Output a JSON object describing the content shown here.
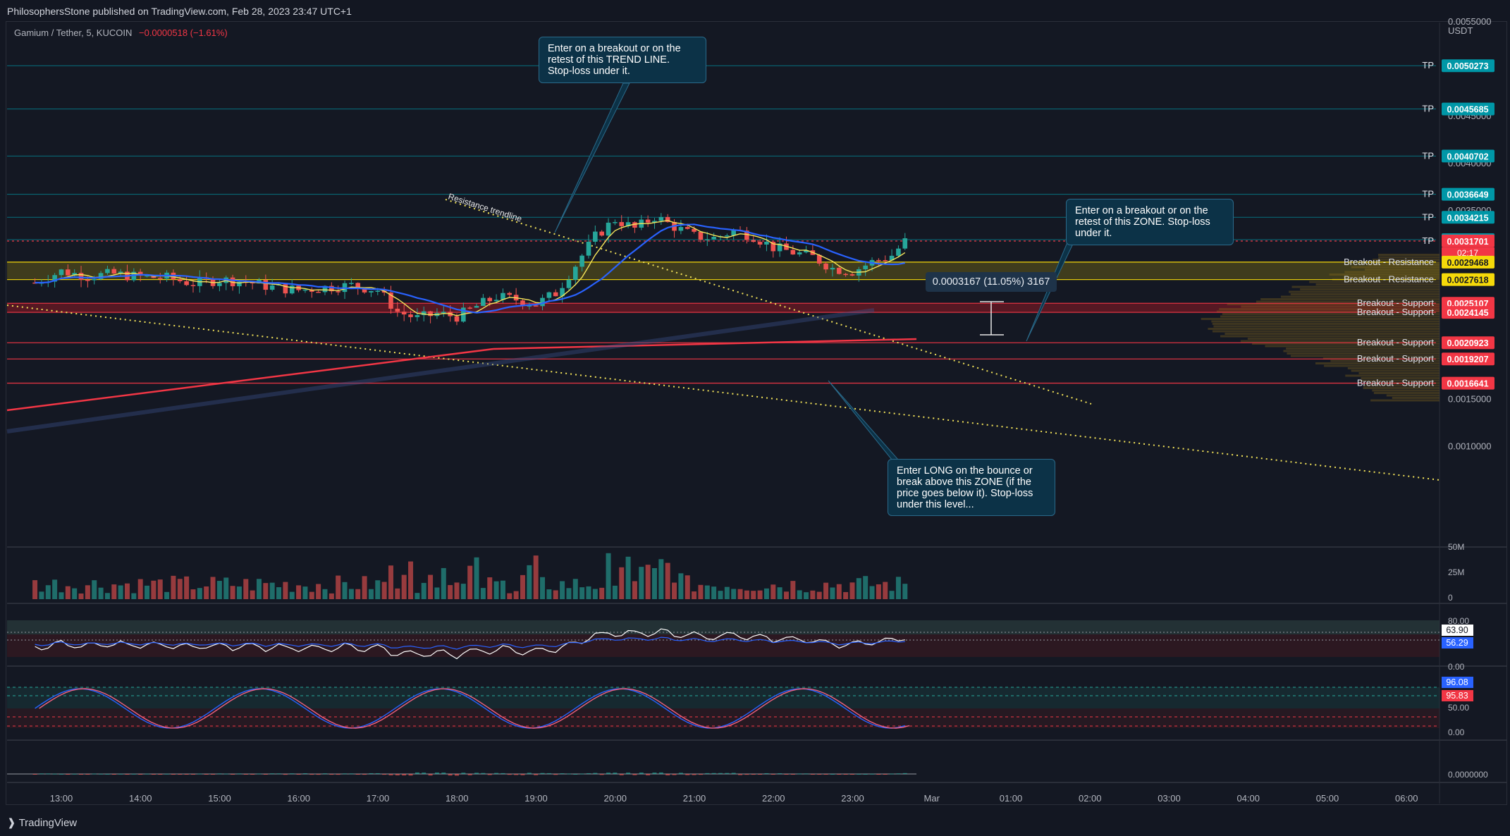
{
  "header": {
    "published": "PhilosophersStone published on TradingView.com, Feb 28, 2023 23:47 UTC+1",
    "symbol": "Gamium / Tether, 5, KUCOIN",
    "change": "−0.0000518 (−1.61%)"
  },
  "footer": {
    "brand": "TradingView",
    "logo_icon": "tradingview-logo-icon"
  },
  "annotations": {
    "trendline_label": "Resistance trendline",
    "callout_trendline": "Enter on a breakout or on the\nretest of this TREND LINE.\nStop-loss under it.",
    "callout_zone": "Enter on a breakout or on the\nretest of this ZONE. Stop-loss\nunder it.",
    "callout_long": "Enter LONG on the bounce or\nbreak above this ZONE (if the\nprice goes below it). Stop-loss\nunder this level...",
    "measure": "0.0003167 (11.05%) 3167"
  },
  "colors": {
    "background": "#131722",
    "up": "#26a69a",
    "down": "#ef5350",
    "tp": "#0097a7",
    "support": "#f23645",
    "resistance": "#f5d90a",
    "ma_fast": "#f5e55a",
    "ma_mid": "#2962ff",
    "ma_slow": "#f23645"
  },
  "chart_data": {
    "type": "candlestick",
    "currency": "USDT",
    "x_ticks": [
      "13:00",
      "14:00",
      "15:00",
      "16:00",
      "17:00",
      "18:00",
      "19:00",
      "20:00",
      "21:00",
      "22:00",
      "23:00",
      "Mar",
      "01:00",
      "02:00",
      "03:00",
      "04:00",
      "05:00",
      "06:00"
    ],
    "y_ticks": [
      "0.0055000",
      "0.0050000",
      "0.0045000",
      "0.0040000",
      "0.0035000",
      "0.0015000",
      "0.0010000"
    ],
    "ylim": [
      0.00088,
      0.00585
    ],
    "levels": [
      {
        "label": "TP",
        "price": "0.0050273",
        "value": 0.0050273,
        "kind": "tp"
      },
      {
        "label": "TP",
        "price": "0.0045685",
        "value": 0.0045685,
        "kind": "tp"
      },
      {
        "label": "TP",
        "price": "0.0040702",
        "value": 0.0040702,
        "kind": "tp"
      },
      {
        "label": "TP",
        "price": "0.0036649",
        "value": 0.0036649,
        "kind": "tp"
      },
      {
        "label": "TP",
        "price": "0.0034215",
        "value": 0.0034215,
        "kind": "tp"
      },
      {
        "label": "",
        "price": "0.0031842",
        "value": 0.0031842,
        "kind": "tp"
      },
      {
        "label": "TP",
        "price": "0.0031701",
        "value": 0.0031701,
        "kind": "last",
        "timer": "02:17"
      },
      {
        "label": "Breakout - Resistance",
        "price": "0.0029468",
        "value": 0.0029468,
        "kind": "resistance"
      },
      {
        "label": "Breakout - Resistance",
        "price": "0.0027618",
        "value": 0.0027618,
        "kind": "resistance"
      },
      {
        "label": "Breakout - Support",
        "price": "0.0025107",
        "value": 0.0025107,
        "kind": "support"
      },
      {
        "label": "Breakout - Support",
        "price": "0.0024145",
        "value": 0.0024145,
        "kind": "support"
      },
      {
        "label": "Breakout - Support",
        "price": "0.0020923",
        "value": 0.0020923,
        "kind": "support"
      },
      {
        "label": "Breakout - Support",
        "price": "0.0019207",
        "value": 0.0019207,
        "kind": "support"
      },
      {
        "label": "Breakout - Support",
        "price": "0.0016641",
        "value": 0.0016641,
        "kind": "support"
      }
    ],
    "price_path": [
      [
        "12:40",
        0.00273
      ],
      [
        "13:00",
        0.00285
      ],
      [
        "13:20",
        0.0028
      ],
      [
        "13:40",
        0.00282
      ],
      [
        "14:00",
        0.00279
      ],
      [
        "14:20",
        0.00278
      ],
      [
        "14:40",
        0.00272
      ],
      [
        "15:00",
        0.00276
      ],
      [
        "15:20",
        0.00274
      ],
      [
        "15:40",
        0.00268
      ],
      [
        "16:00",
        0.00265
      ],
      [
        "16:20",
        0.00268
      ],
      [
        "16:40",
        0.0027
      ],
      [
        "17:00",
        0.00265
      ],
      [
        "17:15",
        0.00242
      ],
      [
        "17:30",
        0.00235
      ],
      [
        "17:45",
        0.0024
      ],
      [
        "18:00",
        0.00237
      ],
      [
        "18:15",
        0.00248
      ],
      [
        "18:30",
        0.00258
      ],
      [
        "18:45",
        0.00255
      ],
      [
        "19:00",
        0.0025
      ],
      [
        "19:15",
        0.00262
      ],
      [
        "19:30",
        0.00292
      ],
      [
        "19:45",
        0.00322
      ],
      [
        "20:00",
        0.0034
      ],
      [
        "20:15",
        0.0033
      ],
      [
        "20:30",
        0.00343
      ],
      [
        "20:45",
        0.00332
      ],
      [
        "21:00",
        0.00322
      ],
      [
        "21:15",
        0.0032
      ],
      [
        "21:30",
        0.00328
      ],
      [
        "21:45",
        0.00322
      ],
      [
        "22:00",
        0.0031
      ],
      [
        "22:15",
        0.00305
      ],
      [
        "22:30",
        0.003
      ],
      [
        "22:45",
        0.00288
      ],
      [
        "23:00",
        0.00285
      ],
      [
        "23:15",
        0.00295
      ],
      [
        "23:30",
        0.00302
      ],
      [
        "23:40",
        0.00317
      ]
    ],
    "volume": {
      "y_ticks": [
        "50M",
        "25M",
        "0"
      ]
    },
    "rsi": {
      "y_ticks": [
        "80.00",
        "0.00"
      ],
      "value": "63.90",
      "signal": "56.29"
    },
    "stoch_rsi": {
      "y_ticks": [
        "50.00",
        "0.00"
      ],
      "k": "96.08",
      "d": "95.83"
    },
    "macd": {
      "y_ticks": [
        "0.0000000"
      ]
    }
  }
}
